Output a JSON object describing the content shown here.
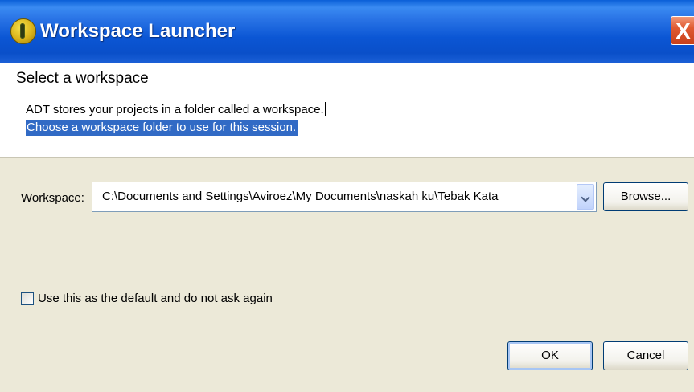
{
  "window": {
    "title": "Workspace Launcher",
    "close_glyph": "X",
    "icon": "adt-app-icon"
  },
  "header": {
    "title": "Select a workspace",
    "message_line1": "ADT stores your projects in a folder called a workspace.",
    "message_line2": "Choose a workspace folder to use for this session."
  },
  "workspace": {
    "label": "Workspace:",
    "value": "C:\\Documents and Settings\\Aviroez\\My Documents\\naskah ku\\Tebak Kata",
    "browse_label": "Browse..."
  },
  "options": {
    "default_checkbox_label": "Use this as the default and do not ask again",
    "default_checked": false
  },
  "footer": {
    "ok_label": "OK",
    "cancel_label": "Cancel"
  },
  "colors": {
    "titlebar": "#0b56d4",
    "selection": "#316ac5",
    "close": "#e05a32",
    "dialog_bg": "#ece9d8"
  }
}
